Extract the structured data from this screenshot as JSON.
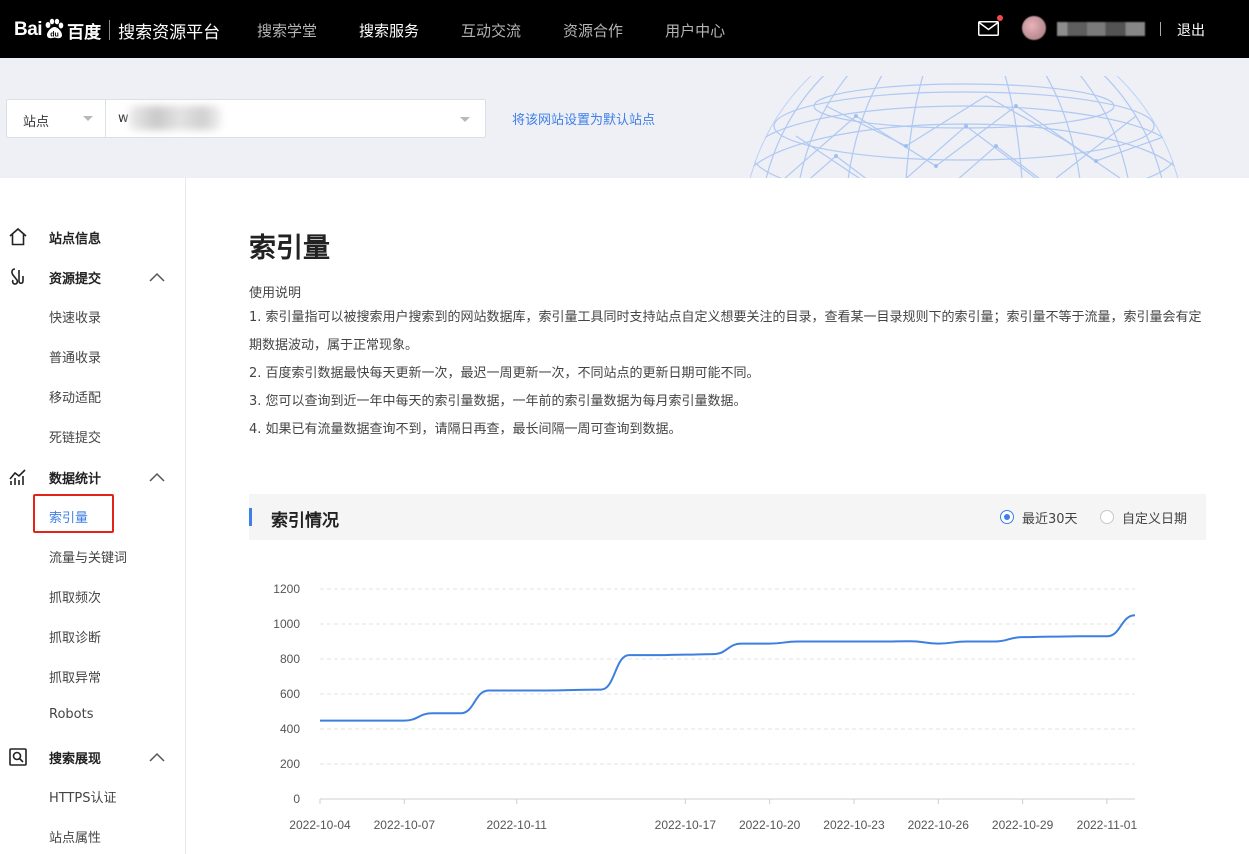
{
  "header": {
    "logo": {
      "bai": "Bai",
      "du_cn": "百度",
      "platform": "搜索资源平台"
    },
    "nav": [
      "搜索学堂",
      "搜索服务",
      "互动交流",
      "资源合作",
      "用户中心"
    ],
    "nav_active": "搜索服务",
    "logout": "退出",
    "has_unread_mail": true
  },
  "sitebar": {
    "site_label": "站点",
    "site_value_prefix": "w",
    "set_default_link": "将该网站设置为默认站点"
  },
  "sidebar": {
    "groups": [
      {
        "label": "站点信息",
        "icon": "home-icon",
        "expandable": false,
        "items": []
      },
      {
        "label": "资源提交",
        "icon": "submit-icon",
        "expandable": true,
        "items": [
          "快速收录",
          "普通收录",
          "移动适配",
          "死链提交"
        ]
      },
      {
        "label": "数据统计",
        "icon": "stats-icon",
        "expandable": true,
        "items": [
          "索引量",
          "流量与关键词",
          "抓取频次",
          "抓取诊断",
          "抓取异常",
          "Robots"
        ]
      },
      {
        "label": "搜索展现",
        "icon": "search-display-icon",
        "expandable": true,
        "items": [
          "HTTPS认证",
          "站点属性"
        ]
      }
    ],
    "active_item": "索引量"
  },
  "main": {
    "title": "索引量",
    "usage_title": "使用说明",
    "usage_lines": [
      "1. 索引量指可以被搜索用户搜索到的网站数据库，索引量工具同时支持站点自定义想要关注的目录，查看某一目录规则下的索引量；索引量不等于流量，索引量会有定期数据波动，属于正常现象。",
      "2. 百度索引数据最快每天更新一次，最迟一周更新一次，不同站点的更新日期可能不同。",
      "3. 您可以查询到近一年中每天的索引量数据，一年前的索引量数据为每月索引量数据。",
      "4. 如果已有流量数据查询不到，请隔日再查，最长间隔一周可查询到数据。"
    ],
    "panel_title": "索引情况",
    "range_options": [
      "最近30天",
      "自定义日期"
    ],
    "range_selected": "最近30天"
  },
  "colors": {
    "accent": "#3f7fe6",
    "line": "#3d7fe0",
    "highlight_box": "#e2231a"
  },
  "chart_data": {
    "type": "line",
    "x": [
      "2022-10-04",
      "2022-10-05",
      "2022-10-06",
      "2022-10-07",
      "2022-10-08",
      "2022-10-09",
      "2022-10-10",
      "2022-10-11",
      "2022-10-12",
      "2022-10-14",
      "2022-10-15",
      "2022-10-16",
      "2022-10-17",
      "2022-10-18",
      "2022-10-19",
      "2022-10-20",
      "2022-10-21",
      "2022-10-22",
      "2022-10-23",
      "2022-10-24",
      "2022-10-25",
      "2022-10-26",
      "2022-10-27",
      "2022-10-28",
      "2022-10-29",
      "2022-10-30",
      "2022-10-31",
      "2022-11-01",
      "2022-11-02"
    ],
    "values": [
      448,
      448,
      448,
      448,
      490,
      490,
      620,
      620,
      620,
      625,
      822,
      822,
      825,
      828,
      888,
      888,
      900,
      900,
      900,
      900,
      902,
      888,
      900,
      900,
      925,
      928,
      930,
      930,
      1050
    ],
    "x_tick_labels": [
      "2022-10-04",
      "2022-10-07",
      "2022-10-11",
      "2022-10-17",
      "2022-10-20",
      "2022-10-23",
      "2022-10-26",
      "2022-10-29",
      "2022-11-01"
    ],
    "y_ticks": [
      "0",
      "200",
      "400",
      "600",
      "800",
      "1000",
      "1200"
    ],
    "ylim": [
      0,
      1200
    ],
    "grid": true
  }
}
